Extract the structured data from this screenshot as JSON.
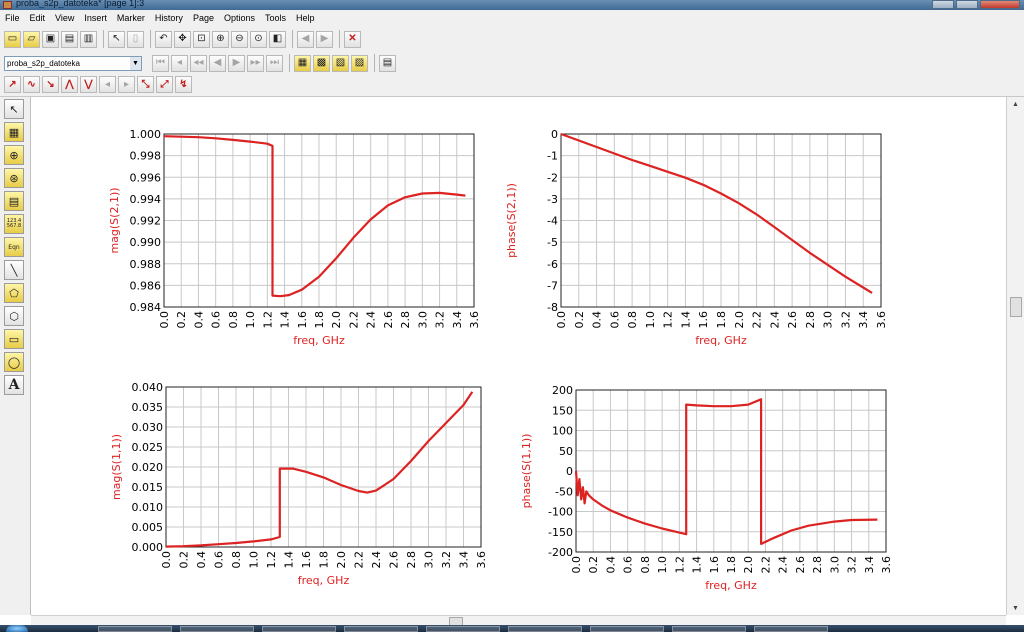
{
  "window": {
    "title": "proba_s2p_datoteka* [page 1]:3",
    "accent": "#3f6a95"
  },
  "menu": [
    "File",
    "Edit",
    "View",
    "Insert",
    "Marker",
    "History",
    "Page",
    "Options",
    "Tools",
    "Help"
  ],
  "toolbar": {
    "design_select_value": "proba_s2p_datoteka",
    "row1_icons": [
      "new-icon",
      "open-icon",
      "save-icon",
      "print-preview-icon",
      "print-icon",
      "select-pointer-icon",
      "delete-icon",
      "undo-icon",
      "move-icon",
      "zoom-area-icon",
      "zoom-in-icon",
      "zoom-out-icon",
      "zoom-fit-icon",
      "zoom-page-icon",
      "previous-page-icon",
      "next-page-icon",
      "close-icon"
    ],
    "row2_icons": [
      "first-icon",
      "step-back-icon",
      "rewind-icon",
      "play-back-icon",
      "play-icon",
      "fast-forward-icon",
      "last-icon",
      "marker-grid-icon",
      "marker-zoom-icon",
      "marker-find-icon",
      "marker-fit-icon",
      "layout-icon"
    ],
    "row3_icons": [
      "marker-new-icon",
      "marker-delta-icon",
      "marker-slope-icon",
      "marker-peak-icon",
      "marker-valley-icon",
      "marker-left-icon",
      "marker-right-icon",
      "marker-move-icon",
      "marker-delete-icon",
      "marker-properties-icon"
    ]
  },
  "palette": [
    "pointer-icon",
    "rectangular-plot-icon",
    "polar-plot-icon",
    "smith-chart-icon",
    "list-icon",
    "stack-table-icon",
    "equation-icon",
    "line-icon",
    "polyline-icon",
    "polygon-icon",
    "rectangle-icon",
    "circle-icon",
    "text-icon"
  ],
  "palette_text": {
    "stack": "123.4 567.8",
    "equation": "Eqn",
    "text": "A"
  },
  "trace_color": "#dd2222",
  "chart_data": [
    {
      "type": "line",
      "title": "",
      "xlabel": "freq, GHz",
      "ylabel": "mag(S(2,1))",
      "xlim": [
        0,
        3.6
      ],
      "ylim": [
        0.984,
        1.0
      ],
      "xticks": [
        "0.0",
        "0.2",
        "0.4",
        "0.6",
        "0.8",
        "1.0",
        "1.2",
        "1.4",
        "1.6",
        "1.8",
        "2.0",
        "2.2",
        "2.4",
        "2.6",
        "2.8",
        "3.0",
        "3.2",
        "3.4",
        "3.6"
      ],
      "yticks": [
        "1.000",
        "0.998",
        "0.996",
        "0.994",
        "0.992",
        "0.990",
        "0.988",
        "0.986",
        "0.984"
      ],
      "x": [
        0,
        0.2,
        0.4,
        0.6,
        0.8,
        1.0,
        1.2,
        1.26,
        1.26,
        1.35,
        1.45,
        1.6,
        1.8,
        2.0,
        2.2,
        2.4,
        2.6,
        2.8,
        3.0,
        3.2,
        3.4,
        3.5
      ],
      "values": [
        0.9998,
        0.99975,
        0.9997,
        0.9996,
        0.99945,
        0.9993,
        0.9991,
        0.9989,
        0.98505,
        0.985,
        0.9851,
        0.9856,
        0.9868,
        0.9885,
        0.9904,
        0.9921,
        0.9934,
        0.99415,
        0.9945,
        0.99455,
        0.9944,
        0.9943
      ]
    },
    {
      "type": "line",
      "title": "",
      "xlabel": "freq, GHz",
      "ylabel": "phase(S(2,1))",
      "xlim": [
        0,
        3.6
      ],
      "ylim": [
        -8,
        0
      ],
      "xticks": [
        "0.0",
        "0.2",
        "0.4",
        "0.6",
        "0.8",
        "1.0",
        "1.2",
        "1.4",
        "1.6",
        "1.8",
        "2.0",
        "2.2",
        "2.4",
        "2.6",
        "2.8",
        "3.0",
        "3.2",
        "3.4",
        "3.6"
      ],
      "yticks": [
        "0",
        "-1",
        "-2",
        "-3",
        "-4",
        "-5",
        "-6",
        "-7",
        "-8"
      ],
      "x": [
        0,
        0.2,
        0.4,
        0.6,
        0.8,
        1.0,
        1.2,
        1.4,
        1.6,
        1.8,
        2.0,
        2.2,
        2.4,
        2.6,
        2.8,
        3.0,
        3.2,
        3.4,
        3.5
      ],
      "values": [
        0,
        -0.3,
        -0.6,
        -0.9,
        -1.2,
        -1.47,
        -1.75,
        -2.02,
        -2.35,
        -2.75,
        -3.2,
        -3.72,
        -4.3,
        -4.9,
        -5.5,
        -6.05,
        -6.6,
        -7.1,
        -7.35
      ]
    },
    {
      "type": "line",
      "title": "",
      "xlabel": "freq, GHz",
      "ylabel": "mag(S(1,1))",
      "xlim": [
        0,
        3.6
      ],
      "ylim": [
        0,
        0.04
      ],
      "xticks": [
        "0.0",
        "0.2",
        "0.4",
        "0.6",
        "0.8",
        "1.0",
        "1.2",
        "1.4",
        "1.6",
        "1.8",
        "2.0",
        "2.2",
        "2.4",
        "2.6",
        "2.8",
        "3.0",
        "3.2",
        "3.4",
        "3.6"
      ],
      "yticks": [
        "0.040",
        "0.035",
        "0.030",
        "0.025",
        "0.020",
        "0.015",
        "0.010",
        "0.005",
        "0.000"
      ],
      "x": [
        0,
        0.2,
        0.4,
        0.6,
        0.8,
        1.0,
        1.2,
        1.3,
        1.3,
        1.45,
        1.6,
        1.8,
        2.0,
        2.2,
        2.3,
        2.4,
        2.6,
        2.8,
        3.0,
        3.2,
        3.4,
        3.5
      ],
      "values": [
        0.0001,
        0.0002,
        0.0004,
        0.0007,
        0.001,
        0.0014,
        0.0019,
        0.0025,
        0.0196,
        0.0196,
        0.0188,
        0.0174,
        0.0155,
        0.014,
        0.0136,
        0.0141,
        0.017,
        0.0215,
        0.0265,
        0.031,
        0.0355,
        0.0388
      ]
    },
    {
      "type": "line",
      "title": "",
      "xlabel": "freq, GHz",
      "ylabel": "phase(S(1,1))",
      "xlim": [
        0,
        3.6
      ],
      "ylim": [
        -200,
        200
      ],
      "xticks": [
        "0.0",
        "0.2",
        "0.4",
        "0.6",
        "0.8",
        "1.0",
        "1.2",
        "1.4",
        "1.6",
        "1.8",
        "2.0",
        "2.2",
        "2.4",
        "2.6",
        "2.8",
        "3.0",
        "3.2",
        "3.4",
        "3.6"
      ],
      "yticks": [
        "200",
        "150",
        "100",
        "50",
        "0",
        "-50",
        "-100",
        "-150",
        "-200"
      ],
      "x": [
        0,
        0.02,
        0.04,
        0.06,
        0.08,
        0.1,
        0.12,
        0.15,
        0.2,
        0.3,
        0.4,
        0.6,
        0.8,
        1.0,
        1.2,
        1.28,
        1.28,
        1.4,
        1.6,
        1.8,
        2.0,
        2.15,
        2.15,
        2.3,
        2.5,
        2.7,
        3.0,
        3.2,
        3.5
      ],
      "values": [
        0,
        -60,
        -20,
        -70,
        -40,
        -80,
        -50,
        -60,
        -70,
        -85,
        -97,
        -115,
        -130,
        -142,
        -152,
        -156,
        164,
        162,
        160,
        160,
        164,
        177,
        -180,
        -165,
        -147,
        -135,
        -125,
        -121,
        -120
      ]
    }
  ]
}
